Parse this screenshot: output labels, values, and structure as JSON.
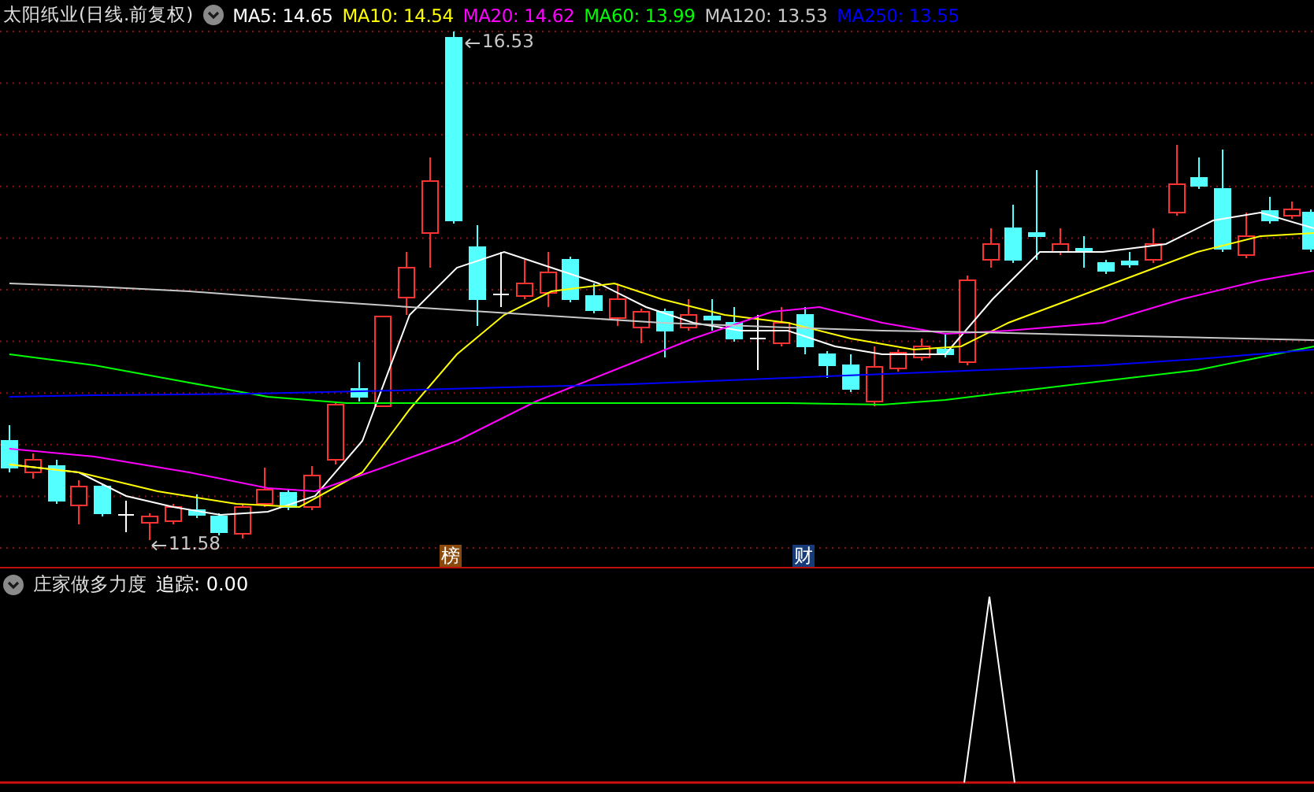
{
  "main_panel": {
    "title": "太阳纸业(日线.前复权)",
    "indicators": [
      {
        "label": "MA5: 14.65",
        "color": "#ffffff"
      },
      {
        "label": "MA10: 14.54",
        "color": "#ffff00"
      },
      {
        "label": "MA20: 14.62",
        "color": "#ff00ff"
      },
      {
        "label": "MA60: 13.99",
        "color": "#00ff00"
      },
      {
        "label": "MA120: 13.53",
        "color": "#c8c8c8"
      },
      {
        "label": "MA250: 13.55",
        "color": "#0000ff"
      }
    ],
    "high_label": "16.53",
    "low_label": "11.58",
    "markers": [
      {
        "text": "榜",
        "color": "#8b4a0c"
      },
      {
        "text": "财",
        "color": "#163b78"
      }
    ]
  },
  "sub_panel": {
    "title": "庄家做多力度",
    "reading": "追踪: 0.00"
  }
}
